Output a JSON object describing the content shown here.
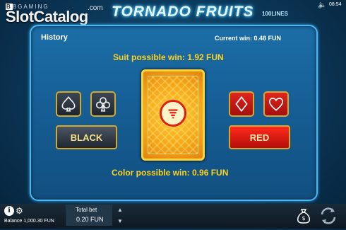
{
  "header": {
    "provider_small": "BGAMING",
    "brand": "SlotCatalog",
    "brand_suffix": ".com",
    "game_title": "TORNADO FRUITS",
    "lines": "100LINES",
    "clock": "08:54"
  },
  "gamble": {
    "history_label": "History",
    "current_win": "Current win: 0.48 FUN",
    "suit_possible_win": "Suit possible win: 1.92 FUN",
    "color_possible_win": "Color possible win: 0.96 FUN",
    "suits": [
      "spades",
      "clubs",
      "diamonds",
      "hearts"
    ],
    "black_label": "BLACK",
    "red_label": "RED"
  },
  "bottom": {
    "balance": "Balance 1,000.30 FUN",
    "total_bet_label": "Total bet",
    "total_bet_value": "0.20 FUN"
  },
  "colors": {
    "accent_yellow": "#ffd21d",
    "panel_blue": "#155d93",
    "red": "#e0261d",
    "gold_border": "#d5aa2a"
  }
}
